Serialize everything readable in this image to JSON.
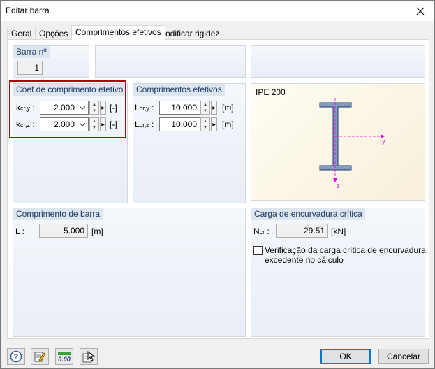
{
  "window": {
    "title": "Editar barra"
  },
  "tabs": [
    {
      "label": "Geral"
    },
    {
      "label": "Opções"
    },
    {
      "label": "Comprimentos efetivos"
    },
    {
      "label": "Modificar rigidez"
    }
  ],
  "active_tab": "Comprimentos efetivos",
  "barra": {
    "header": "Barra nº",
    "value": "1"
  },
  "coef": {
    "header": "Coef.de comprimento efetivo",
    "rows": [
      {
        "label_main": "k",
        "label_sub": "cr,y",
        "colon": " :",
        "value": "2.000",
        "unit": "[-]"
      },
      {
        "label_main": "k",
        "label_sub": "cr,z",
        "colon": " :",
        "value": "2.000",
        "unit": "[-]"
      }
    ]
  },
  "comprimentos": {
    "header": "Comprimentos efetivos",
    "rows": [
      {
        "label_main": "L",
        "label_sub": "cr,y",
        "colon": " :",
        "value": "10.000",
        "unit": "[m]"
      },
      {
        "label_main": "L",
        "label_sub": "cr,z",
        "colon": " :",
        "value": "10.000",
        "unit": "[m]"
      }
    ]
  },
  "section": {
    "name": "IPE 200",
    "axis_y": "y",
    "axis_z": "z"
  },
  "comprimento_barra": {
    "header": "Comprimento de barra",
    "label": "L :",
    "value": "5.000",
    "unit": "[m]"
  },
  "carga": {
    "header": "Carga de encurvadura crítica",
    "label_main": "N",
    "label_sub": "cr",
    "colon": " :",
    "value": "29.51",
    "unit": "[kN]",
    "checkbox_line1": "Verificação da carga crítica de encurvadura",
    "checkbox_line2": "excedente no cálculo",
    "checked": false
  },
  "buttons": {
    "ok": "OK",
    "cancel": "Cancelar"
  },
  "icons": [
    "help-icon",
    "edit-icon",
    "units-icon",
    "select-icon"
  ],
  "colors": {
    "highlight": "#b00000",
    "group_header": "#1e3c64",
    "section_fill": "#8aa0c8",
    "axis": "#e000e0"
  }
}
